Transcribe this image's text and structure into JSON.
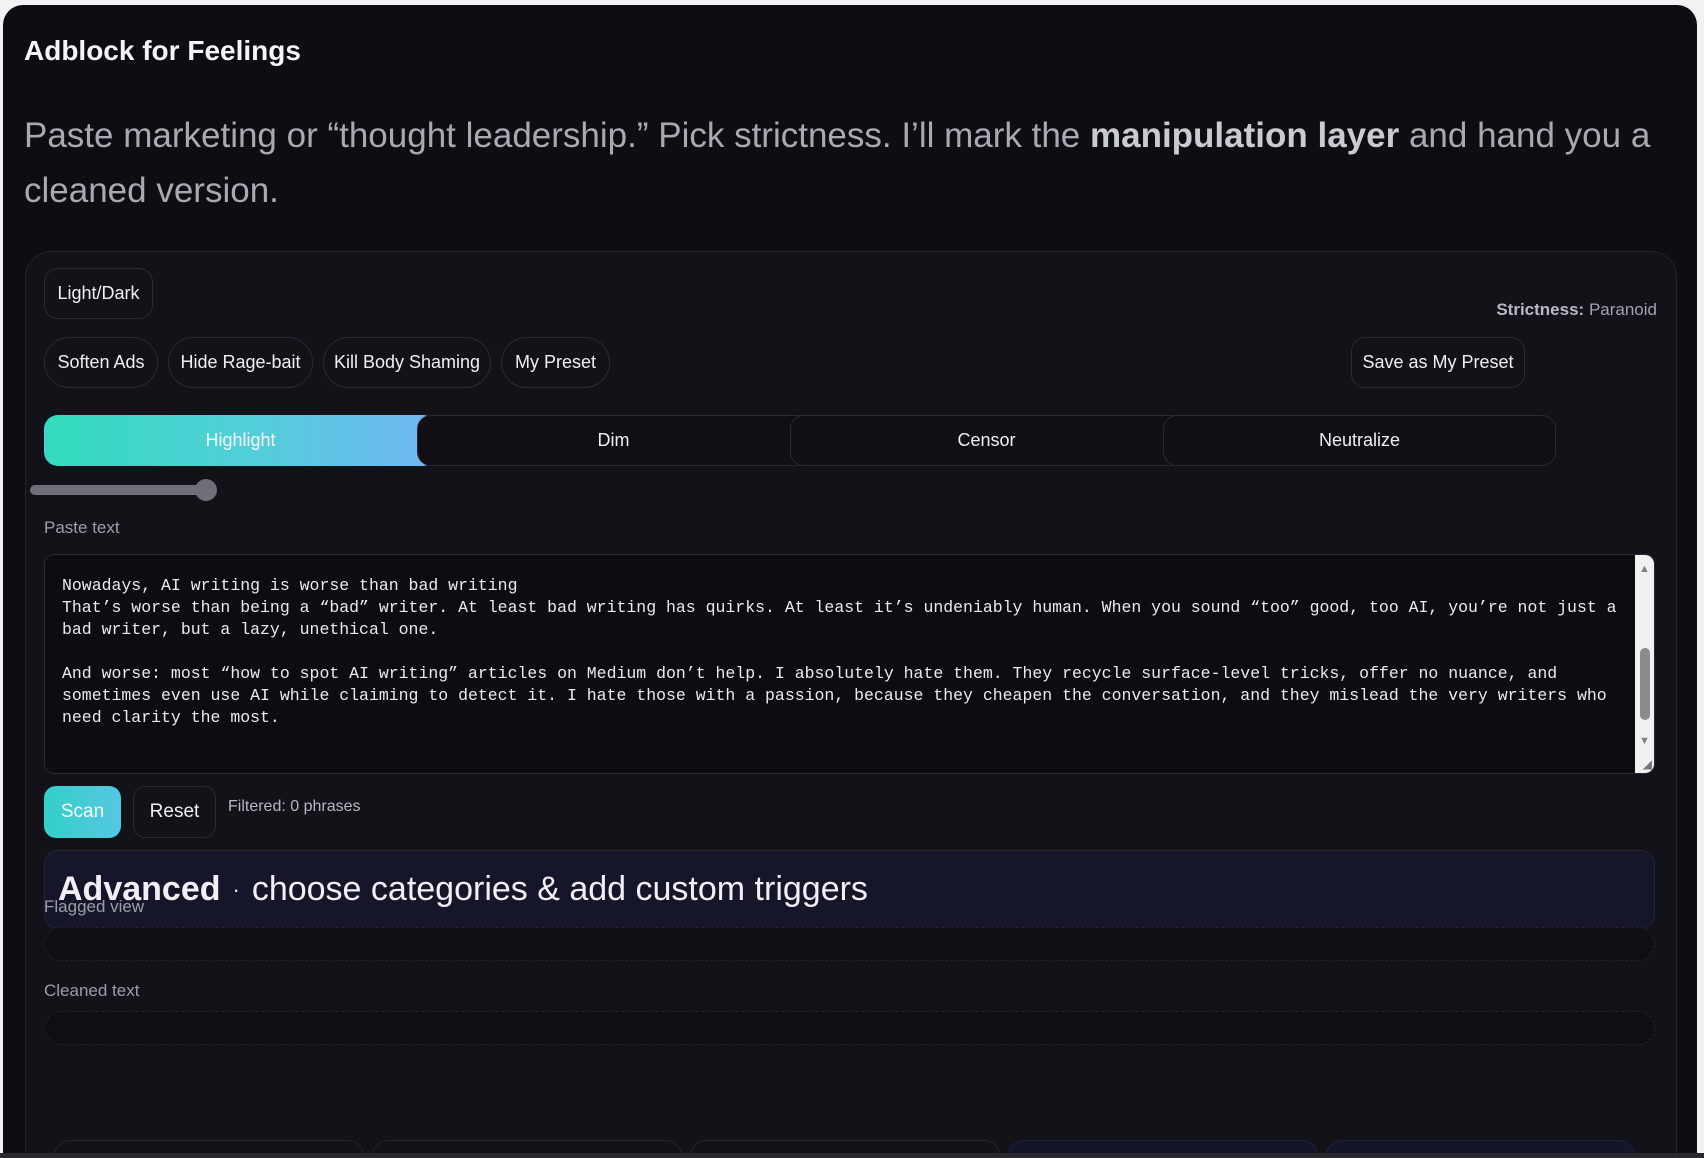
{
  "app": {
    "title": "Adblock for Feelings"
  },
  "intro": {
    "pre": "Paste marketing or “thought leadership.” Pick strictness. I’ll mark the ",
    "bold": "manipulation layer",
    "post": " and hand you a cleaned version."
  },
  "controls": {
    "theme_toggle": "Light/Dark",
    "strictness_label": "Strictness:",
    "strictness_value": "Paranoid",
    "presets": [
      "Soften Ads",
      "Hide Rage-bait",
      "Kill Body Shaming",
      "My Preset"
    ],
    "save_preset": "Save as My Preset",
    "modes": [
      "Highlight",
      "Dim",
      "Censor",
      "Neutralize"
    ],
    "active_mode": "Highlight",
    "strictness_slider_level": 1.0
  },
  "input": {
    "label": "Paste text",
    "value": "Nowadays, AI writing is worse than bad writing\nThat’s worse than being a “bad” writer. At least bad writing has quirks. At least it’s undeniably human. When you sound “too” good, too AI, you’re not just a bad writer, but a lazy, unethical one.\n\nAnd worse: most “how to spot AI writing” articles on Medium don’t help. I absolutely hate them. They recycle surface-level tricks, offer no nuance, and sometimes even use AI while claiming to detect it. I hate those with a passion, because they cheapen the conversation, and they mislead the very writers who need clarity the most."
  },
  "actions": {
    "scan": "Scan",
    "reset": "Reset",
    "filtered": "Filtered: 0 phrases"
  },
  "advanced": {
    "title": "Advanced",
    "separator": "·",
    "subtitle": "choose categories & add custom triggers"
  },
  "output": {
    "flagged_label": "Flagged view",
    "flagged_value": "",
    "cleaned_label": "Cleaned text",
    "cleaned_value": ""
  },
  "colors": {
    "background": "#0d0d12",
    "panel": "#121219",
    "accent_start": "#33dcbc",
    "accent_end": "#72b6f4"
  }
}
